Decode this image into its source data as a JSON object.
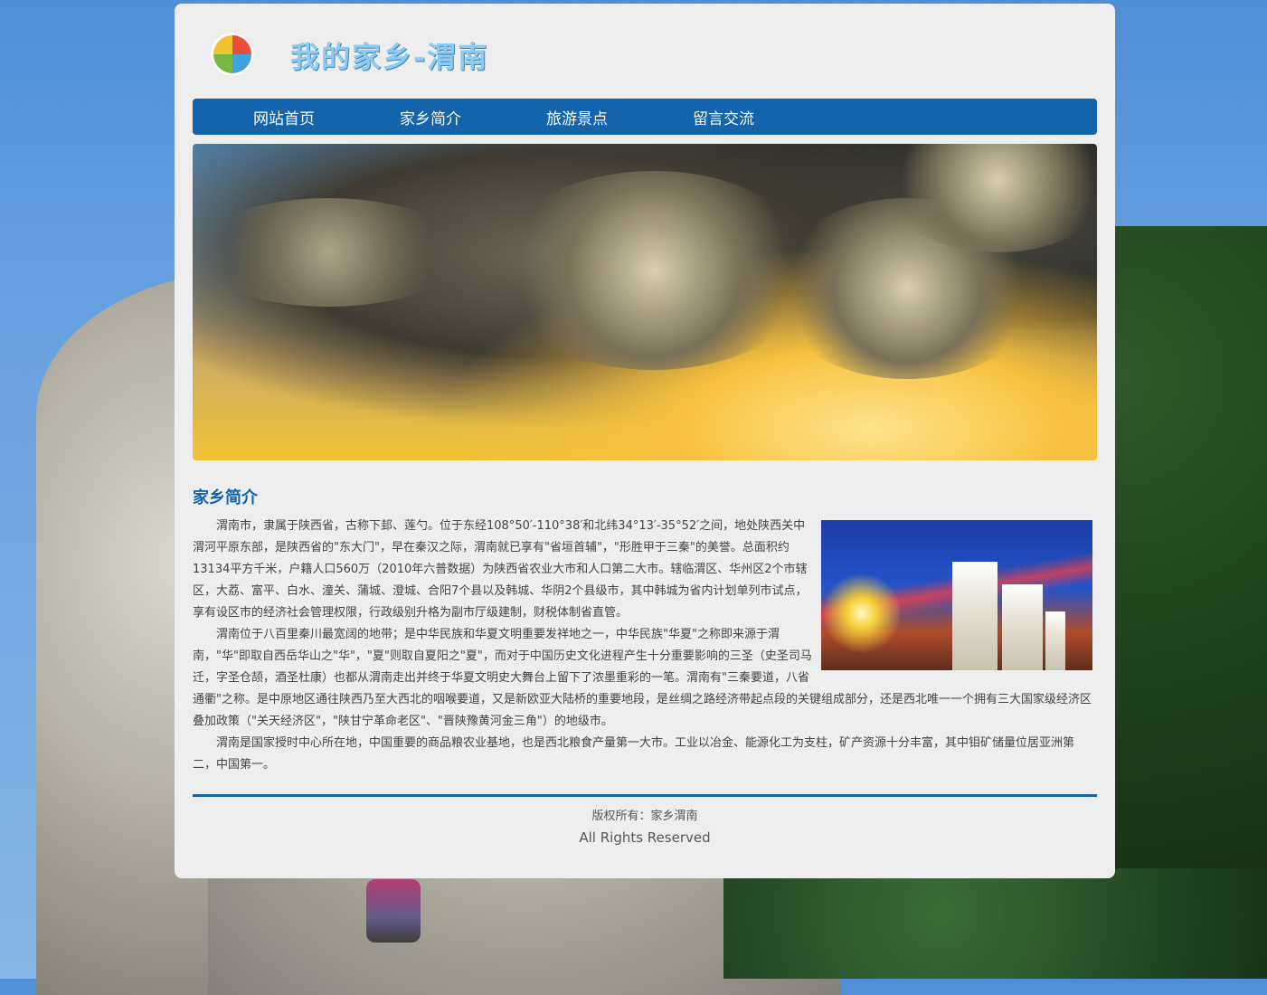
{
  "header": {
    "site_title": "我的家乡-渭南",
    "logo_icon": "landscape-logo-icon"
  },
  "nav": {
    "items": [
      {
        "label": "网站首页"
      },
      {
        "label": "家乡简介"
      },
      {
        "label": "旅游景点"
      },
      {
        "label": "留言交流"
      }
    ]
  },
  "banner": {
    "image": "sunset-clouds-photo"
  },
  "section": {
    "title": "家乡简介",
    "side_image": "city-night-buildings-photo",
    "paragraphs": [
      "渭南市，隶属于陕西省，古称下邽、莲勺。位于东经108°50′-110°38′和北纬34°13′-35°52′之间，地处陕西关中渭河平原东部，是陕西省的\"东大门\"，早在秦汉之际，渭南就已享有\"省垣首辅\"，\"形胜甲于三秦\"的美誉。总面积约13134平方千米，户籍人口560万（2010年六普数据）为陕西省农业大市和人口第二大市。辖临渭区、华州区2个市辖区，大荔、富平、白水、潼关、蒲城、澄城、合阳7个县以及韩城、华阴2个县级市，其中韩城为省内计划单列市试点，享有设区市的经济社会管理权限，行政级别升格为副市厅级建制，财税体制省直管。",
      "渭南位于八百里秦川最宽阔的地带；是中华民族和华夏文明重要发祥地之一，中华民族\"华夏\"之称即来源于渭南，\"华\"即取自西岳华山之\"华\"，\"夏\"则取自夏阳之\"夏\"，而对于中国历史文化进程产生十分重要影响的三圣（史圣司马迁，字圣仓颉，酒圣杜康）也都从渭南走出并终于华夏文明史大舞台上留下了浓墨重彩的一笔。渭南有\"三秦要道，八省通衢\"之称。是中原地区通往陕西乃至大西北的咽喉要道，又是新欧亚大陆桥的重要地段，是丝绸之路经济带起点段的关键组成部分，还是西北唯一一个拥有三大国家级经济区叠加政策（\"关天经济区\"，\"陕甘宁革命老区\"、\"晋陕豫黄河金三角\"）的地级市。",
      "渭南是国家授时中心所在地，中国重要的商品粮农业基地，也是西北粮食产量第一大市。工业以冶金、能源化工为支柱，矿产资源十分丰富，其中钼矿储量位居亚洲第二，中国第一。"
    ]
  },
  "footer": {
    "copyright": "版权所有：家乡渭南",
    "rights": "All Rights Reserved"
  },
  "colors": {
    "nav_bg": "#1463ad",
    "container_bg": "#eeeeee",
    "title_blue": "#1463ad"
  }
}
